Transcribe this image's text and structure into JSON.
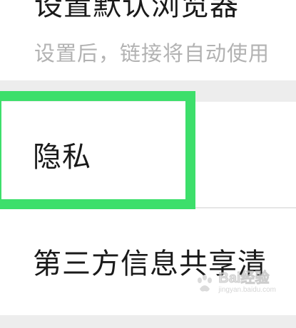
{
  "settings": {
    "default_browser": {
      "title": "设置默认浏览器",
      "description": "设置后，链接将自动使用"
    },
    "privacy": {
      "title": "隐私"
    },
    "third_party": {
      "title": "第三方信息共享清"
    }
  },
  "highlight": {
    "color": "#3ddf6b"
  },
  "watermark": {
    "brand": "Bai经验",
    "url": "jingyan.baidu.com"
  }
}
